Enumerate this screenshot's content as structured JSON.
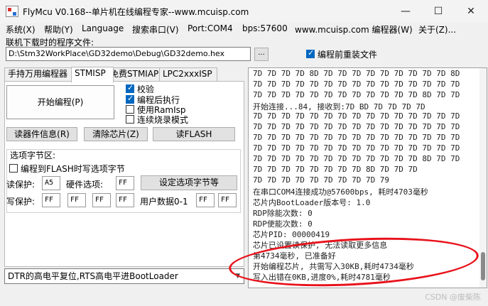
{
  "window": {
    "title": "FlyMcu V0.168--单片机在线编程专家--www.mcuisp.com",
    "minimize": "—",
    "maximize": "☐",
    "close": "✕"
  },
  "menu": {
    "items": [
      "系统(X)",
      "帮助(Y)",
      "Language",
      "搜索串口(V)",
      "Port:COM4",
      "bps:57600",
      "www.mcuisp.com 编程器(W)",
      "关于(Z)..."
    ]
  },
  "file": {
    "label": "联机下载时的程序文件:",
    "path": "D:\\Stm32WorkPlace\\GD32demo\\Debug\\GD32demo.hex",
    "browse": "...",
    "reload_label": "编程前重装文件",
    "reload_checked": true
  },
  "tabs": [
    "手持万用编程器",
    "STMISP",
    "免费STMIAP",
    "LPC2xxxISP"
  ],
  "actions": {
    "start": "开始编程(P)",
    "read_info": "读器件信息(R)",
    "erase": "清除芯片(Z)",
    "read_flash": "读FLASH"
  },
  "options": {
    "verify": "校验",
    "run_after": "编程后执行",
    "use_ramisp": "使用RamIsp",
    "continuous": "连续烧录模式"
  },
  "option_bytes": {
    "group_label": "选项字节区:",
    "write_to_flash": "编程到FLASH时写选项字节",
    "read_protect_label": "读保护:",
    "read_protect_value": "A5",
    "hw_option_label": "硬件选项:",
    "hw_option_value": "FF",
    "set_button": "设定选项字节等",
    "write_protect_label": "写保护:",
    "wp": [
      "FF",
      "FF",
      "FF",
      "FF"
    ],
    "user_data_label": "用户数据0-1",
    "user_data": [
      "FF",
      "FF"
    ]
  },
  "reset_mode": "DTR的高电平复位,RTS高电平进BootLoader",
  "log": [
    "7D 7D 7D 7D 8D 7D 7D 7D 7D 7D 7D 7D 7D 7D 8D",
    "7D 7D 7D 7D 7D 7D 7D 7D 7D 7D 7D 7D 7D 7D 7D",
    "7D 7D 7D 7D 7D 7D 7D 7D 7D 7D 7D 7D 8D 7D 7D",
    "开始连接...84, 接收到:7D BD 7D 7D 7D 7D",
    "7D 7D 7D 7D 7D 7D 7D 7D 7D 7D 7D 7D 7D 7D 7D",
    "7D 7D 7D 7D 7D 7D 7D 7D 7D 7D 7D 7D 7D 7D 7D",
    "7D 7D 7D 7D 7D 7D 7D 7D 7D 7D 7D 7D 7D 7D 7D",
    "7D 7D 7D 7D 7D 7D 7D 7D 7D 7D 7D 7D 7D 7D 7D",
    "7D 7D 7D 7D 7D 7D 7D 7D 7D 7D 7D 7D 8D 7D 7D",
    "7D 7D 7D 7D 7D 7D 7D 7D 8D 7D 7D 7D",
    "7D 7D 7D 7D 7D 7D 7D 7D 7D 79",
    "在串口COM4连接成功@57600bps, 耗时4703毫秒",
    "芯片内BootLoader版本号: 1.0",
    "RDP除能次数: 0",
    "RDP使能次数: 0",
    "芯片PID: 00000419",
    "芯片已设置读保护, 无法读取更多信息",
    "第4734毫秒, 已准备好",
    "开始编程芯片, 共需写入30KB,耗时4734毫秒",
    "写入出错在0KB,进度0%,耗时4781毫秒"
  ],
  "watermark": "CSDN @废柴陈",
  "colors": {
    "accent": "#0067c0",
    "annotation": "#e8121b"
  }
}
